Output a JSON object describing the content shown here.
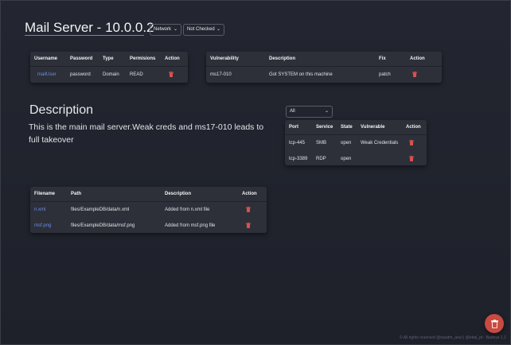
{
  "header": {
    "title": "Mail Server - 10.0.0.2",
    "network_select": "Network",
    "status_select": "Not Checked"
  },
  "credentials": {
    "columns": [
      "Username",
      "Password",
      "Type",
      "Permisions",
      "Action"
    ],
    "rows": [
      {
        "username": "mailUser",
        "password": "password",
        "type": "Domain",
        "permissions": "READ"
      }
    ]
  },
  "vulnerabilities": {
    "columns": [
      "Vulnerability",
      "Description",
      "Fix",
      "Action"
    ],
    "rows": [
      {
        "vulnerability": "ms17-010",
        "description": "Got SYSTEM on this machine",
        "fix": "patch"
      }
    ]
  },
  "description": {
    "heading": "Description",
    "text": "This is the main mail server.Weak creds and ms17-010 leads to full takeover"
  },
  "ports": {
    "filter_select": "All",
    "columns": [
      "Port",
      "Service",
      "State",
      "Vulnerable",
      "Action"
    ],
    "rows": [
      {
        "port": "tcp-445",
        "service": "SMB",
        "state": "open",
        "vulnerable": "Weak Credentials"
      },
      {
        "port": "tcp-3389",
        "service": "RDP",
        "state": "open",
        "vulnerable": ""
      }
    ]
  },
  "files": {
    "columns": [
      "Filename",
      "Path",
      "Description",
      "Action"
    ],
    "rows": [
      {
        "filename": "n.xml",
        "path": "files/ExampleDB/data/n.xml",
        "description": "Added from n.xml file"
      },
      {
        "filename": "msf.png",
        "path": "files/ExampleDB/data/msf.png",
        "description": "Added from msf.png file"
      }
    ]
  },
  "footer": {
    "text": "© All rights reserved @daudm_anul | @ebal_pt - Badeye 1.1"
  },
  "colors": {
    "accent": "#6f8ce0",
    "danger": "#c84a40",
    "trash": "#d9534f"
  }
}
